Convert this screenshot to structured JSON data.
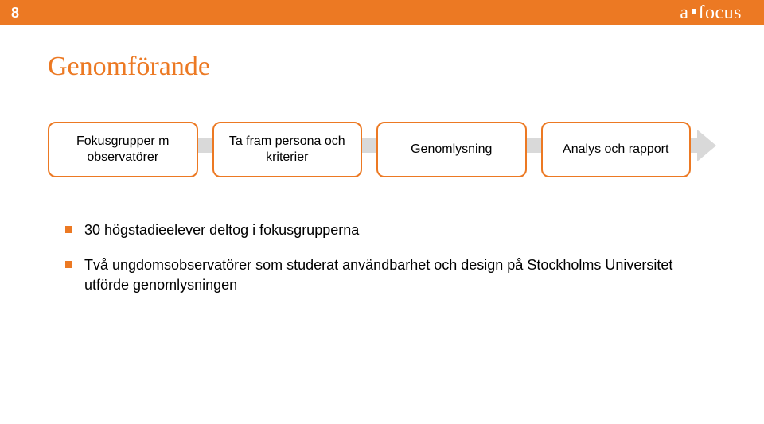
{
  "header": {
    "page_number": "8",
    "logo_prefix": "a",
    "logo_suffix": "focus"
  },
  "title": "Genomförande",
  "flow": {
    "steps": [
      "Fokusgrupper m observatörer",
      "Ta fram persona och kriterier",
      "Genomlysning",
      "Analys och rapport"
    ]
  },
  "bullets": [
    "30 högstadieelever deltog i fokusgrupperna",
    "Två ungdomsobservatörer som studerat användbarhet och design på Stockholms Universitet utförde genomlysningen"
  ]
}
